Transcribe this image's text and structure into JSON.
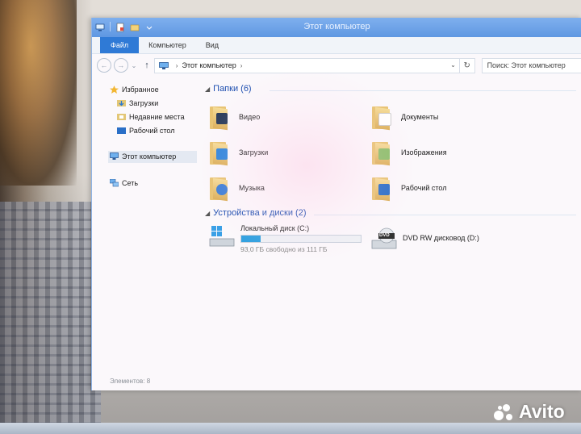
{
  "window": {
    "title": "Этот компьютер"
  },
  "ribbon": {
    "tabs": [
      {
        "label": "Файл"
      },
      {
        "label": "Компьютер"
      },
      {
        "label": "Вид"
      }
    ]
  },
  "address": {
    "path": "Этот компьютер",
    "search_placeholder": "Поиск: Этот компьютер"
  },
  "navpane": {
    "favorites_label": "Избранное",
    "favorites": [
      {
        "label": "Загрузки"
      },
      {
        "label": "Недавние места"
      },
      {
        "label": "Рабочий стол"
      }
    ],
    "this_pc_label": "Этот компьютер",
    "network_label": "Сеть"
  },
  "folders_group": {
    "header": "Папки (6)",
    "items": [
      {
        "label": "Видео"
      },
      {
        "label": "Документы"
      },
      {
        "label": "Загрузки"
      },
      {
        "label": "Изображения"
      },
      {
        "label": "Музыка"
      },
      {
        "label": "Рабочий стол"
      }
    ]
  },
  "devices_group": {
    "header": "Устройства и диски (2)",
    "local_disk": {
      "label": "Локальный диск (C:)",
      "free_text": "93,0 ГБ свободно из 111 ГБ",
      "used_fraction": 0.16
    },
    "dvd": {
      "label": "DVD RW дисковод (D:)",
      "badge": "DVD"
    }
  },
  "status": {
    "items_count": "Элементов: 8"
  },
  "watermark": {
    "text": "Avito"
  },
  "colors": {
    "title_bar": "#6aa3e8",
    "file_tab": "#2f7ad6",
    "group_header": "#1e4fb0",
    "disk_fill": "#31a1e0"
  }
}
